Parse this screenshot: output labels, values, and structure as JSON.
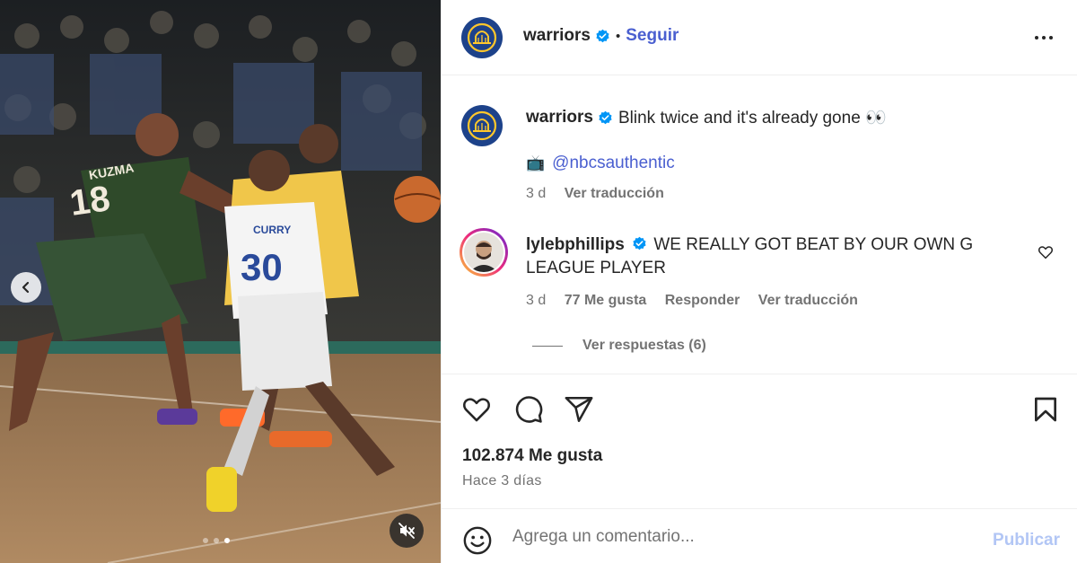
{
  "post": {
    "account": "warriors",
    "follow_label": "Seguir",
    "separator": "•"
  },
  "caption": {
    "username": "warriors",
    "text": "Blink twice and it's already gone 👀",
    "credit_emoji": "📺",
    "credit_mention": "@nbcsauthentic",
    "age": "3 d",
    "translate_label": "Ver traducción"
  },
  "comment": {
    "username": "lylebphillips",
    "text": "WE REALLY GOT BEAT BY OUR OWN G LEAGUE PLAYER",
    "age": "3 d",
    "likes": "77 Me gusta",
    "reply_label": "Responder",
    "translate_label": "Ver traducción",
    "view_replies_label": "Ver respuestas (6)"
  },
  "stats": {
    "likes": "102.874 Me gusta",
    "posted": "Hace 3 días"
  },
  "composer": {
    "placeholder": "Agrega un comentario...",
    "publish_label": "Publicar"
  },
  "media": {
    "slide_count": 3,
    "active_slide": 3,
    "jersey_left": "18",
    "jersey_left_name": "KUZMA",
    "jersey_right": "30",
    "jersey_right_name": "CURRY"
  },
  "icons": {
    "nav_prev": "chevron-left-icon",
    "mute": "speaker-muted-icon",
    "more": "more-options-icon",
    "like": "heart-icon",
    "comment": "comment-bubble-icon",
    "share": "paper-plane-icon",
    "save": "bookmark-icon",
    "emoji": "emoji-smile-icon",
    "verified": "verified-badge-icon"
  },
  "colors": {
    "link": "#4a5fd0",
    "verified": "#0095f6",
    "publish_disabled": "#b2c6f5",
    "warriors_blue": "#1d428a",
    "warriors_gold": "#ffc72c"
  }
}
